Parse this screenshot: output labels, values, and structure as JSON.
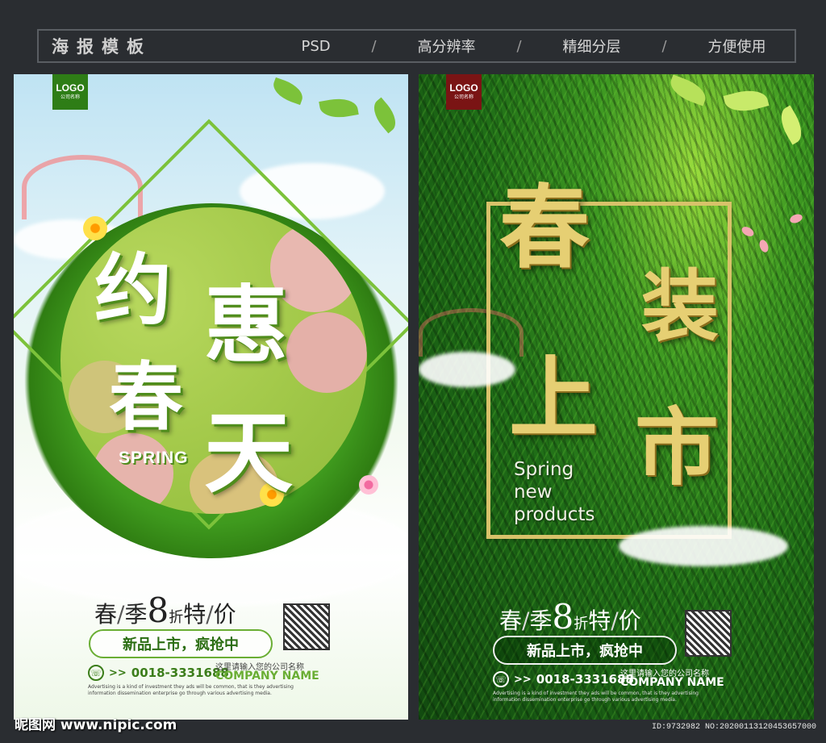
{
  "header": {
    "title": "海报模板",
    "items": [
      "PSD",
      "高分辨率",
      "精细分层",
      "方便使用"
    ],
    "separator": "/"
  },
  "poster1": {
    "logo": {
      "text": "LOGO",
      "sub": "公司名称"
    },
    "title_chars": [
      "约",
      "惠",
      "春",
      "天"
    ],
    "spring_label": "SPRING",
    "price": {
      "a": "春",
      "s1": "/",
      "b": "季",
      "num": "8",
      "unit": "折",
      "c": "特",
      "s2": "/",
      "d": "价"
    },
    "slogan": "新品上市，疯抢中",
    "phone": "0018-3331688",
    "phone_prefix": ">>",
    "company_cn": "这里请输入您的公司名称",
    "company_en": "COMPANY NAME",
    "ad_lines": [
      "Advertising is a kind of investment they ads will be common, that is they advertising",
      "information dissemination enterprise go through various advertising media."
    ]
  },
  "poster2": {
    "logo": {
      "text": "LOGO",
      "sub": "公司名称"
    },
    "title_chars": [
      "春",
      "装",
      "上",
      "市"
    ],
    "spring_lines": [
      "Spring",
      "new",
      "products"
    ],
    "price": {
      "a": "春",
      "s1": "/",
      "b": "季",
      "num": "8",
      "unit": "折",
      "c": "特",
      "s2": "/",
      "d": "价"
    },
    "slogan": "新品上市，疯抢中",
    "phone": "0018-3331688",
    "phone_prefix": ">>",
    "company_cn": "这里请输入您的公司名称",
    "company_en": "COMPANY NAME",
    "ad_lines": [
      "Advertising is a kind of investment they ads will be common, that is they advertising",
      "information dissemination enterprise go through various advertising media."
    ]
  },
  "footer": {
    "watermark": "昵图网 www.nipic.com",
    "id_text": "ID:9732982 NO:20200113120453657000"
  },
  "colors": {
    "background": "#2a2d31",
    "green": "#3f9a1e",
    "gold": "#e6cf73"
  }
}
